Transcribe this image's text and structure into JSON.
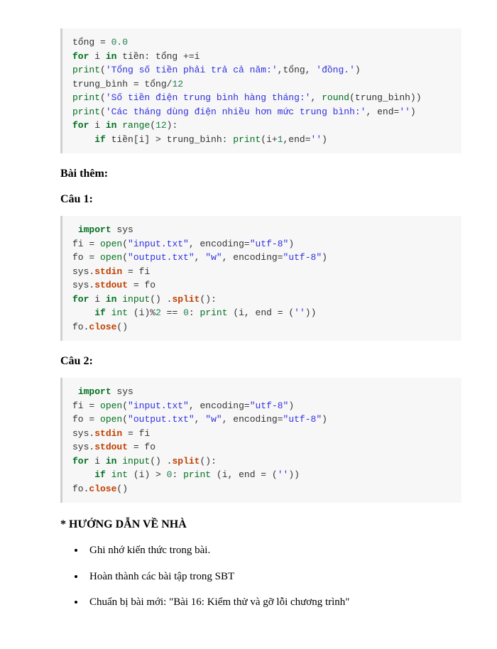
{
  "code_block_1": {
    "line1": {
      "a": "tổng = ",
      "num": "0.0"
    },
    "line2": {
      "kw1": "for",
      "t1": " i ",
      "kw2": "in",
      "t2": " tiền: tổng +=i"
    },
    "line3": {
      "bi": "print",
      "t1": "(",
      "str": "'Tổng số tiền phải trả cả năm:'",
      "t2": ",tổng, ",
      "str2": "'đồng.'",
      "t3": ")"
    },
    "line4": {
      "t1": "trung_bình = tổng/",
      "num": "12"
    },
    "line5": {
      "bi": "print",
      "t1": "(",
      "str": "'Số tiền điện trung bình hàng tháng:'",
      "t2": ", ",
      "bi2": "round",
      "t3": "(trung_bình))"
    },
    "line6": {
      "bi": "print",
      "t1": "(",
      "str": "'Các tháng dùng điện nhiều hơn mức trung bình:'",
      "t2": ", end=",
      "str2": "''",
      "t3": ")"
    },
    "line7": {
      "kw1": "for",
      "t1": " i ",
      "kw2": "in",
      "t2": " ",
      "bi": "range",
      "t3": "(",
      "num": "12",
      "t4": "):"
    },
    "line8": {
      "indent": "    ",
      "kw": "if",
      "t1": " tiền[i] > trung_bình: ",
      "bi": "print",
      "t2": "(i+",
      "num": "1",
      "t3": ",end=",
      "str": "''",
      "t4": ")"
    }
  },
  "heading_extra": "Bài thêm:",
  "heading_q1": "Câu 1:",
  "code_block_2": {
    "line1": {
      "indent": " ",
      "kw": "import",
      "t": " sys"
    },
    "line2": {
      "t1": "fi = ",
      "bi": "open",
      "t2": "(",
      "str1": "\"input.txt\"",
      "t3": ", encoding=",
      "str2": "\"utf-8\"",
      "t4": ")"
    },
    "line3": {
      "t1": "fo = ",
      "bi": "open",
      "t2": "(",
      "str1": "\"output.txt\"",
      "t3": ", ",
      "str2": "\"w\"",
      "t4": ", encoding=",
      "str3": "\"utf-8\"",
      "t5": ")"
    },
    "line4": {
      "t1": "sys.",
      "attr": "stdin",
      "t2": " = fi"
    },
    "line5": {
      "t1": "sys.",
      "attr": "stdout",
      "t2": " = fo"
    },
    "line6": {
      "kw1": "for",
      "t1": " i ",
      "kw2": "in",
      "t2": " ",
      "bi": "input",
      "t3": "() .",
      "attr": "split",
      "t4": "():"
    },
    "line7": {
      "indent": "    ",
      "kw": "if",
      "t1": " ",
      "bi": "int",
      "t2": " (i)%",
      "num1": "2",
      "t3": " == ",
      "num2": "0",
      "t4": ": ",
      "bi2": "print",
      "t5": " (i, end = (",
      "str": "''",
      "t6": "))"
    },
    "line8": {
      "t1": "fo.",
      "attr": "close",
      "t2": "()"
    }
  },
  "heading_q2": "Câu 2:",
  "code_block_3": {
    "line1": {
      "indent": " ",
      "kw": "import",
      "t": " sys"
    },
    "line2": {
      "t1": "fi = ",
      "bi": "open",
      "t2": "(",
      "str1": "\"input.txt\"",
      "t3": ", encoding=",
      "str2": "\"utf-8\"",
      "t4": ")"
    },
    "line3": {
      "t1": "fo = ",
      "bi": "open",
      "t2": "(",
      "str1": "\"output.txt\"",
      "t3": ", ",
      "str2": "\"w\"",
      "t4": ", encoding=",
      "str3": "\"utf-8\"",
      "t5": ")"
    },
    "line4": {
      "t1": "sys.",
      "attr": "stdin",
      "t2": " = fi"
    },
    "line5": {
      "t1": "sys.",
      "attr": "stdout",
      "t2": " = fo"
    },
    "line6": {
      "kw1": "for",
      "t1": " i ",
      "kw2": "in",
      "t2": " ",
      "bi": "input",
      "t3": "() .",
      "attr": "split",
      "t4": "():"
    },
    "line7": {
      "indent": "    ",
      "kw": "if",
      "t1": " ",
      "bi": "int",
      "t2": " (i) > ",
      "num": "0",
      "t3": ": ",
      "bi2": "print",
      "t4": " (i, end = (",
      "str": "''",
      "t5": "))"
    },
    "line8": {
      "t1": "fo.",
      "attr": "close",
      "t2": "()"
    }
  },
  "heading_homework": "* HƯỚNG DẪN VỀ NHÀ",
  "bullets": [
    "Ghi nhớ kiến thức trong bài.",
    "Hoàn thành các bài tập trong SBT",
    "Chuẩn bị bài mới: \"Bài 16: Kiểm thử và gỡ lỗi chương trình\""
  ]
}
